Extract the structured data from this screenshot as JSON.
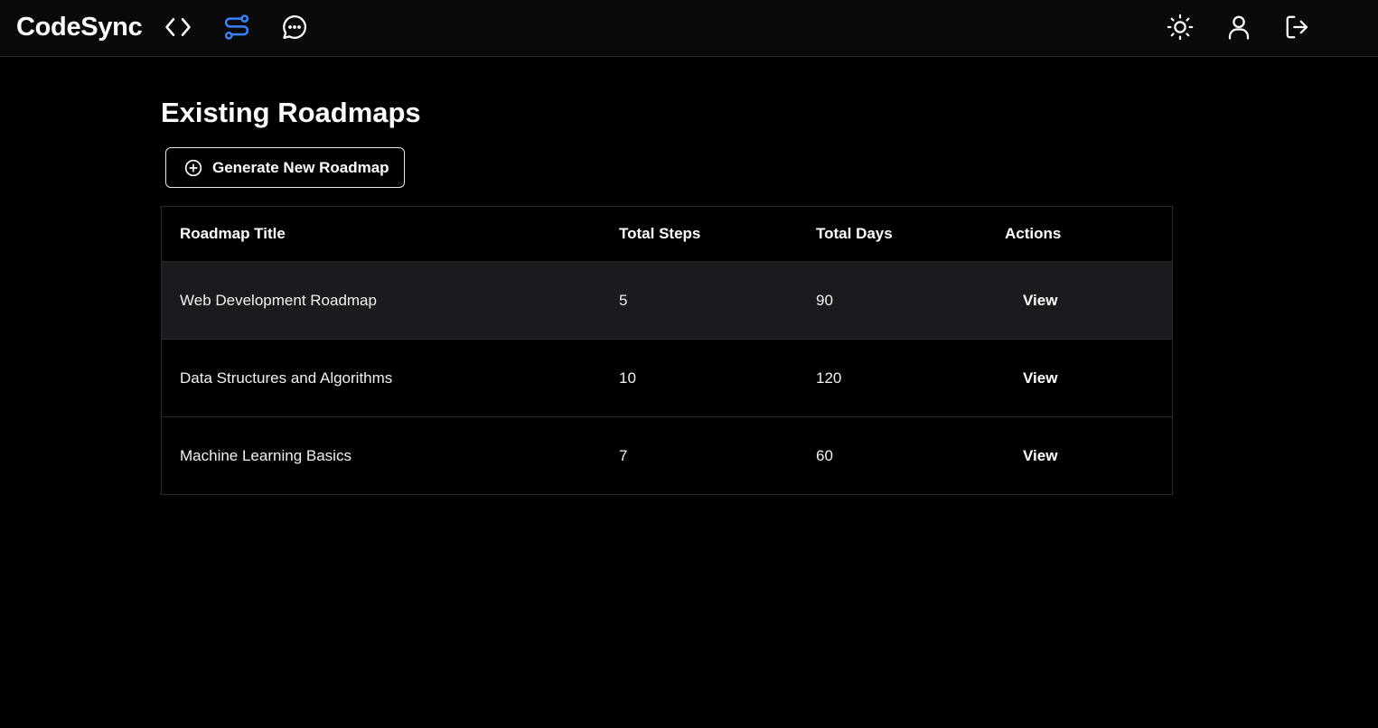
{
  "app": {
    "brand": "CodeSync",
    "accent_color": "#3b82f6",
    "nav_icons": [
      "code-icon",
      "roadmap-icon",
      "chat-icon"
    ],
    "right_icons": [
      "sun-icon",
      "user-icon",
      "logout-icon"
    ],
    "active_nav": "roadmap-icon"
  },
  "page": {
    "title": "Existing Roadmaps",
    "generate_button": {
      "label": "Generate New Roadmap",
      "icon": "plus-circle-icon"
    }
  },
  "table": {
    "headers": {
      "title": "Roadmap Title",
      "steps": "Total Steps",
      "days": "Total Days",
      "actions": "Actions"
    },
    "rows": [
      {
        "title": "Web Development Roadmap",
        "steps": "5",
        "days": "90",
        "action": "View"
      },
      {
        "title": "Data Structures and Algorithms",
        "steps": "10",
        "days": "120",
        "action": "View"
      },
      {
        "title": "Machine Learning Basics",
        "steps": "7",
        "days": "60",
        "action": "View"
      }
    ]
  }
}
